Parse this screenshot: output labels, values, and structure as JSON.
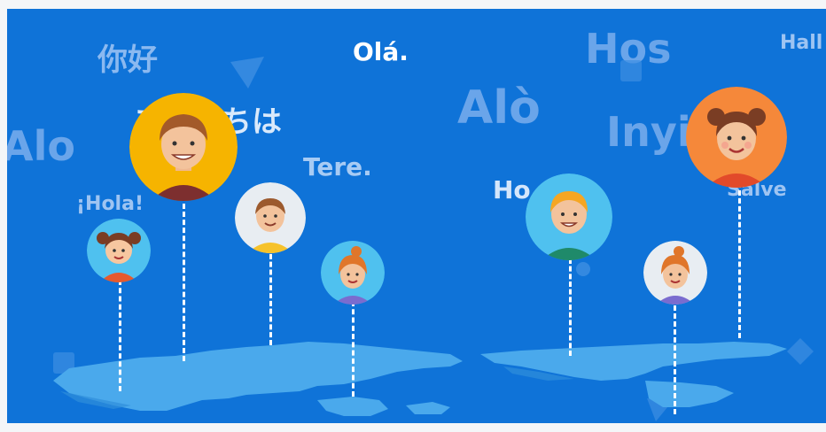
{
  "greetings": {
    "nihao": "你好",
    "ola": "Olá.",
    "hos": "Hos",
    "hall": "Hall",
    "konnichiwa": "こんにちは",
    "alo_left": "Alo",
    "alo_mid": "Alò",
    "inyi": "Inyi",
    "tere": "Tere.",
    "hola": "¡Hola!",
    "ho": "Ho",
    "salve": "Salve"
  },
  "colors": {
    "background": "#0f73d8",
    "map": "#4aa9ec",
    "pin_line": "#ffffff"
  }
}
